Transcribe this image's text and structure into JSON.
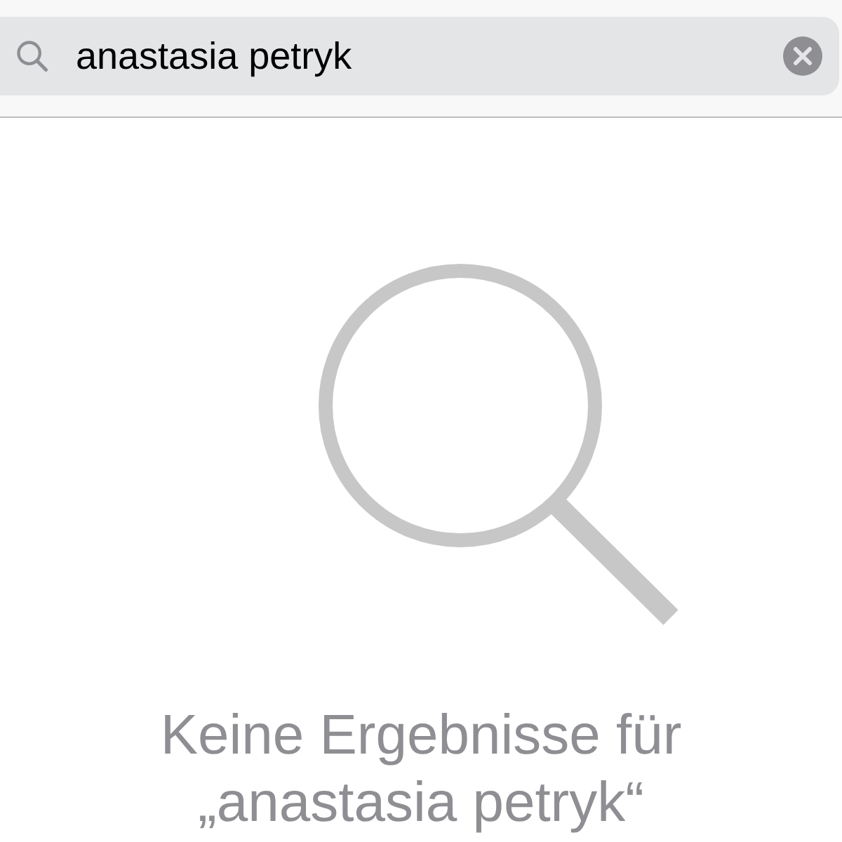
{
  "search": {
    "value": "anastasia petryk"
  },
  "empty_state": {
    "lines": [
      "Keine Ergebnisse für",
      "„anastasia petryk“"
    ]
  }
}
